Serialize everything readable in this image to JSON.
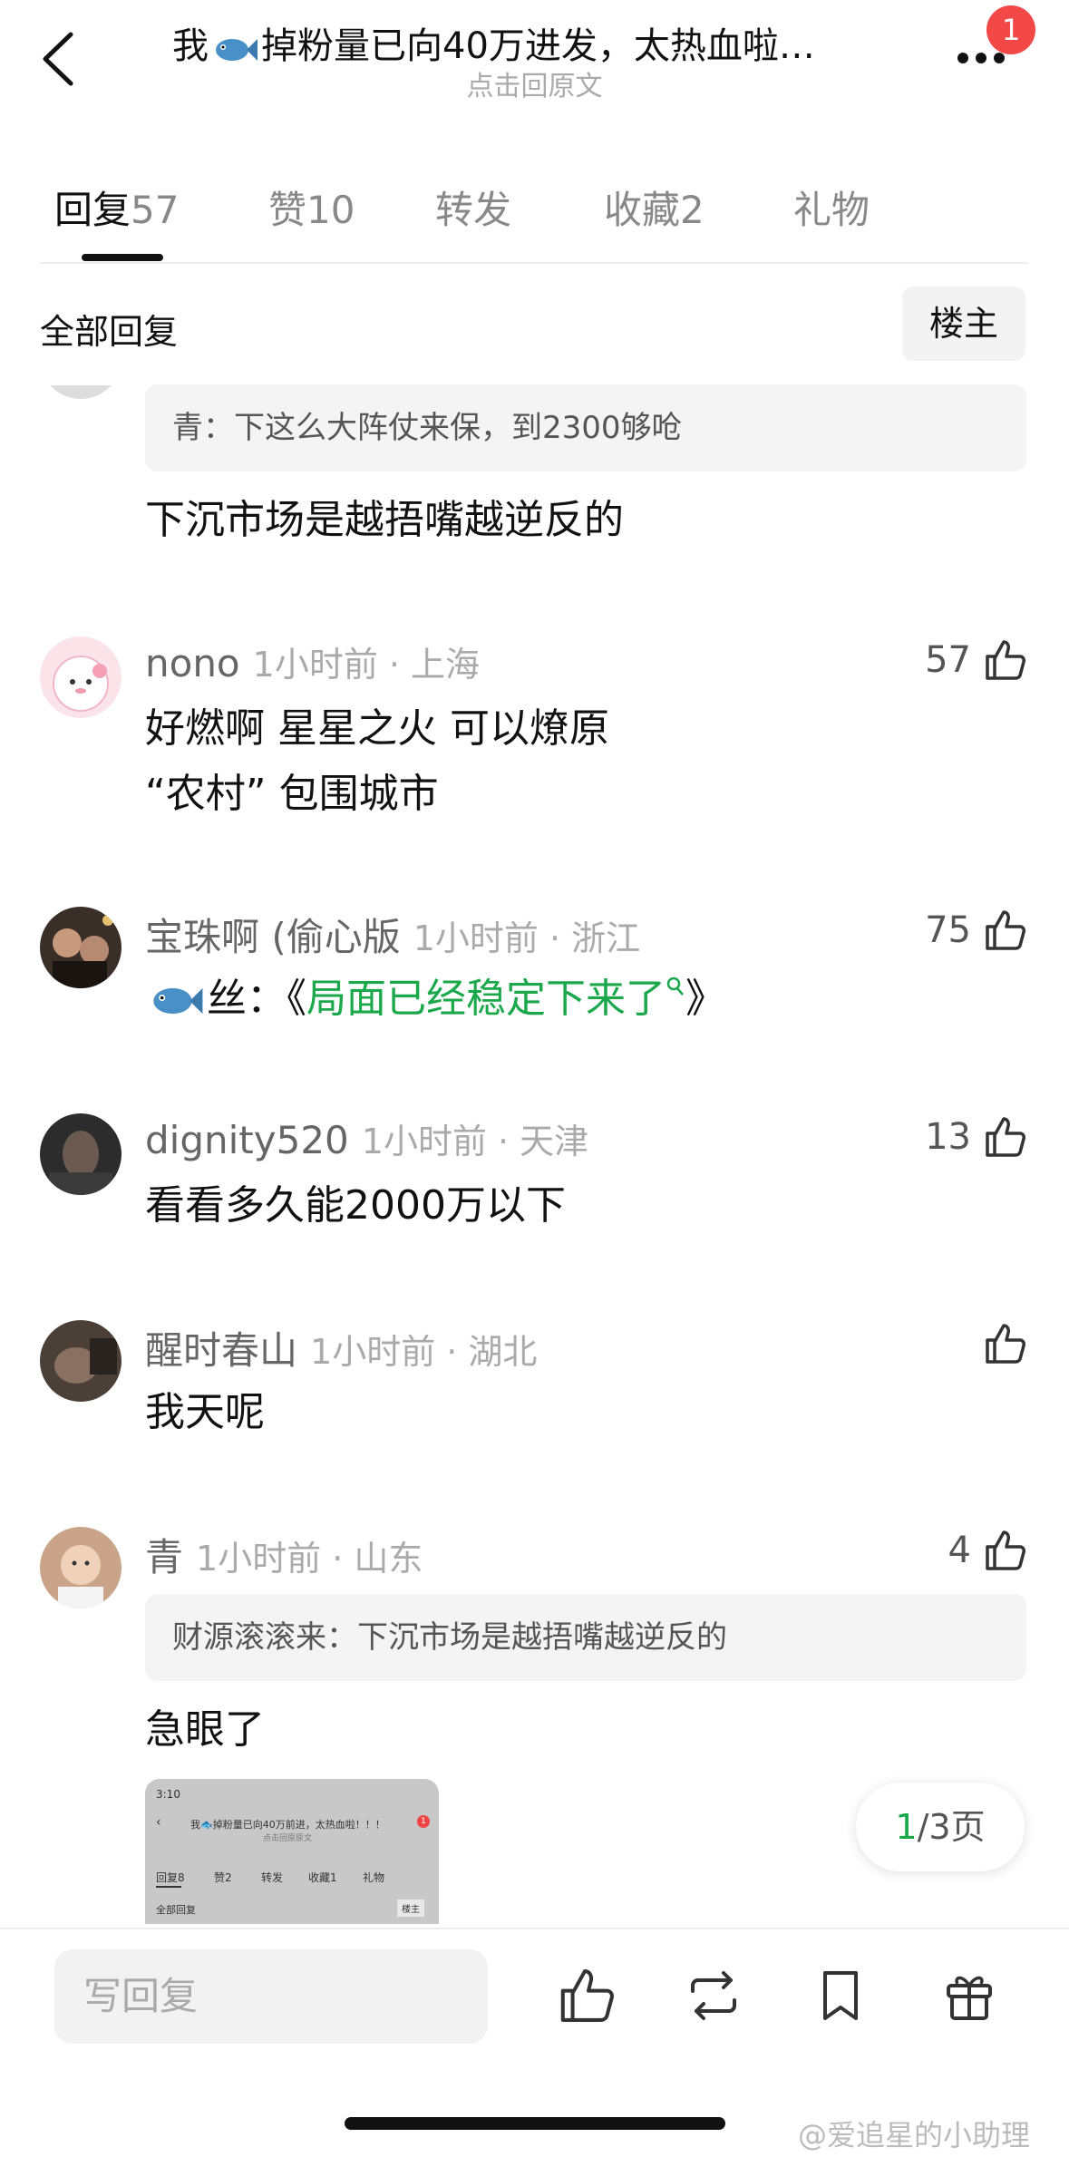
{
  "header": {
    "title_prefix": "我",
    "title_rest": "掉粉量已向40万进发，太热血啦…",
    "subtitle": "点击回原文",
    "notification_count": "1"
  },
  "tabs": [
    {
      "label": "回复",
      "count": "57"
    },
    {
      "label": "赞",
      "count": "10"
    },
    {
      "label": "转发",
      "count": ""
    },
    {
      "label": "收藏",
      "count": "2"
    },
    {
      "label": "礼物",
      "count": ""
    }
  ],
  "filter": {
    "all_replies": "全部回复",
    "owner_only": "楼主"
  },
  "comments": [
    {
      "quote": "青：下这么大阵仗来保，到2300够呛",
      "lines": [
        "下沉市场是越捂嘴越逆反的"
      ]
    },
    {
      "username": "nono",
      "time_loc": "1小时前 · 上海",
      "likes": "57",
      "lines": [
        "好燃啊 星星之火 可以燎原",
        "“农村” 包围城市"
      ]
    },
    {
      "username": "宝珠啊 (偷心版",
      "time_loc": "1小时前 · 浙江",
      "likes": "75",
      "text_prefix": "丝：《",
      "text_link": "局面已经稳定下来了",
      "text_suffix": "》"
    },
    {
      "username": "dignity520",
      "time_loc": "1小时前 · 天津",
      "likes": "13",
      "lines": [
        "看看多久能2000万以下"
      ]
    },
    {
      "username": "醒时春山",
      "time_loc": "1小时前 · 湖北",
      "likes": "",
      "lines": [
        "我天呢"
      ]
    },
    {
      "username": "青",
      "time_loc": "1小时前 · 山东",
      "likes": "4",
      "quote": "财源滚滚来：下沉市场是越捂嘴越逆反的",
      "lines": [
        "急眼了"
      ]
    }
  ],
  "thumbnail": {
    "status_time": "3:10",
    "title": "我🐟掉粉量已向40万前进，太热血啦！！！",
    "subtitle": "点击回原原文",
    "tabs": [
      "回复8",
      "赞2",
      "转发",
      "收藏1",
      "礼物"
    ],
    "all_replies": "全部回复",
    "owner_only": "楼主",
    "badge": "1"
  },
  "pagination": {
    "current": "1",
    "total_text": "/3页"
  },
  "bottom_bar": {
    "reply_placeholder": "写回复"
  },
  "watermark": "@爱追星的小助理",
  "colors": {
    "accent_green": "#1aa84a",
    "badge_red": "#f24848"
  }
}
